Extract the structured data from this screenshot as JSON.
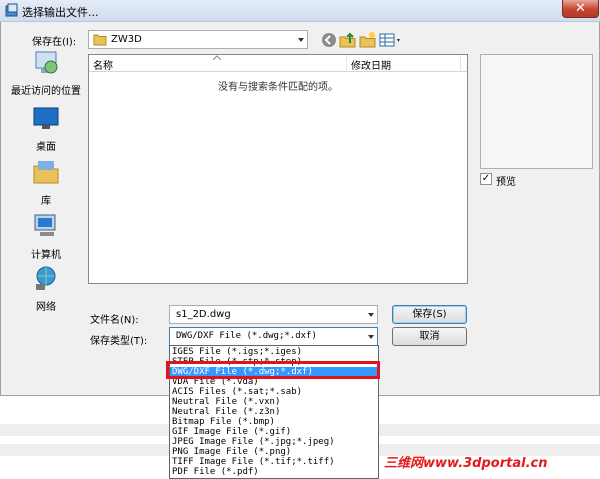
{
  "window": {
    "title": "选择输出文件...",
    "close_glyph": "✕"
  },
  "toolbar": {
    "save_in_label": "保存在(I):",
    "folder_value": "ZW3D",
    "icons": [
      "back-icon",
      "up-folder-icon",
      "new-folder-icon",
      "view-menu-icon"
    ]
  },
  "places": [
    {
      "label": "最近访问的位置",
      "icon": "recent-places-icon"
    },
    {
      "label": "桌面",
      "icon": "desktop-icon"
    },
    {
      "label": "库",
      "icon": "libraries-icon"
    },
    {
      "label": "计算机",
      "icon": "computer-icon"
    },
    {
      "label": "网络",
      "icon": "network-icon"
    }
  ],
  "filelist": {
    "columns": [
      "名称",
      "修改日期"
    ],
    "empty_message": "没有与搜索条件匹配的项。"
  },
  "preview": {
    "label": "预览",
    "checked": true,
    "check_glyph": "✓"
  },
  "form": {
    "filename_label": "文件名(N):",
    "filename_value": "s1_2D.dwg",
    "filetype_label": "保存类型(T):",
    "filetype_value": "DWG/DXF File (*.dwg;*.dxf)",
    "save_button": "保存(S)",
    "cancel_button": "取消"
  },
  "filetype_options": [
    {
      "label": "IGES File (*.igs;*.iges)",
      "selected": false
    },
    {
      "label": "STEP File (*.stp;*.step)",
      "selected": false
    },
    {
      "label": "DWG/DXF File (*.dwg;*.dxf)",
      "selected": true
    },
    {
      "label": "VDA File (*.vda)",
      "selected": false
    },
    {
      "label": "ACIS Files (*.sat;*.sab)",
      "selected": false
    },
    {
      "label": "Neutral File (*.vxn)",
      "selected": false
    },
    {
      "label": "Neutral File (*.z3n)",
      "selected": false
    },
    {
      "label": "Bitmap File (*.bmp)",
      "selected": false
    },
    {
      "label": "GIF Image File (*.gif)",
      "selected": false
    },
    {
      "label": "JPEG Image File (*.jpg;*.jpeg)",
      "selected": false
    },
    {
      "label": "PNG Image File (*.png)",
      "selected": false
    },
    {
      "label": "TIFF Image File (*.tif;*.tiff)",
      "selected": false
    },
    {
      "label": "PDF File (*.pdf)",
      "selected": false
    }
  ],
  "watermark": "三维网www.3dportal.cn",
  "colors": {
    "highlight_border": "#e0131e",
    "selection": "#3399ff",
    "watermark": "#e41b1b"
  }
}
